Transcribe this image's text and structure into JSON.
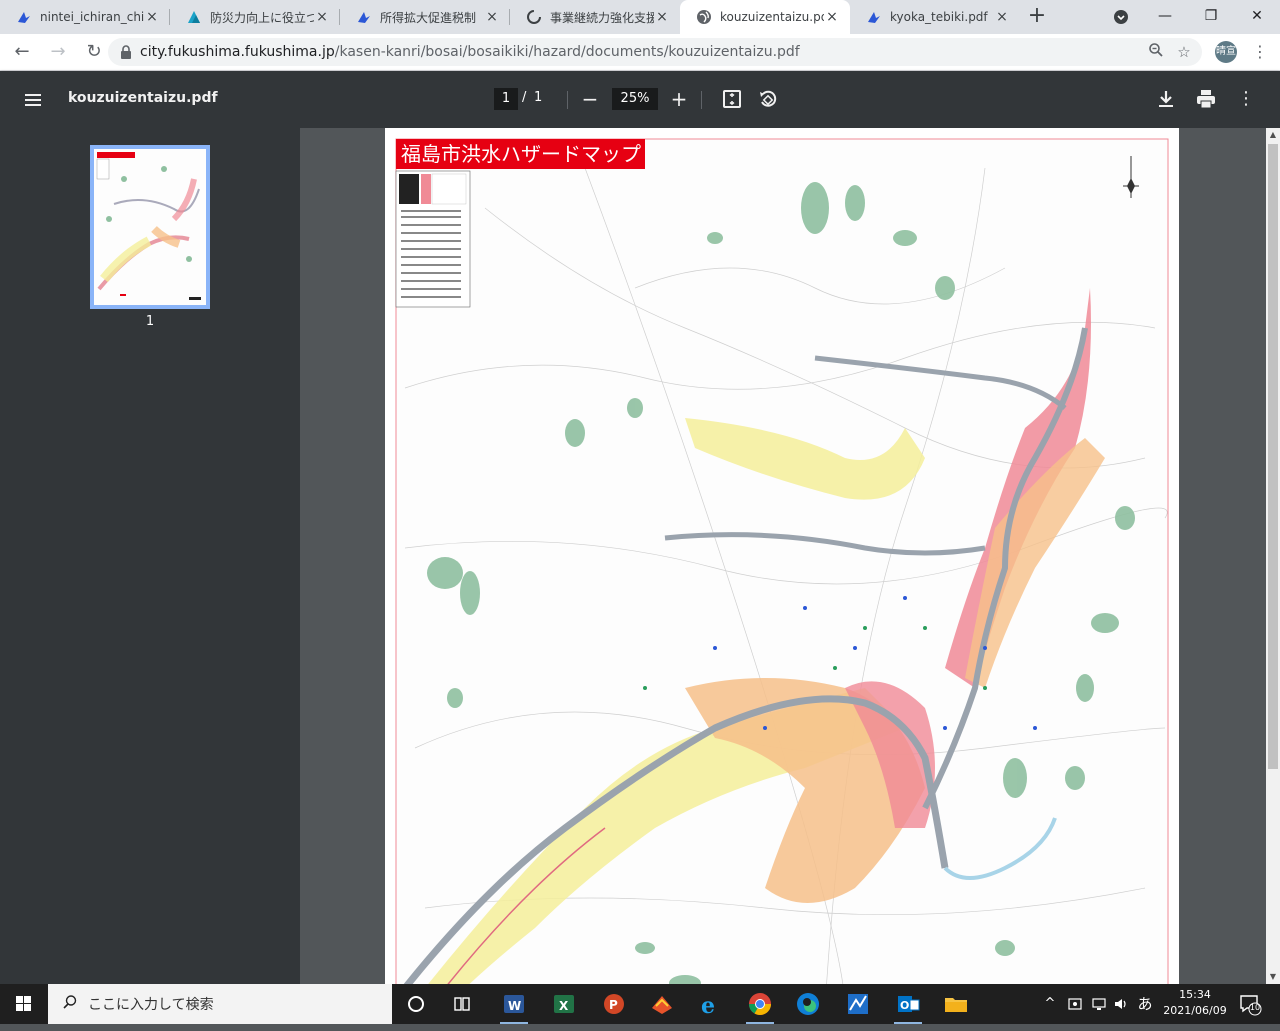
{
  "browser": {
    "tabs": [
      {
        "title": "nintei_ichiran_chiiki",
        "icon": "pdf-icon",
        "active": false
      },
      {
        "title": "防災力向上に役立つ",
        "icon": "site-icon",
        "active": false
      },
      {
        "title": "所得拡大促進税制 ",
        "icon": "pdf-icon",
        "active": false
      },
      {
        "title": "事業継続力強化支援",
        "icon": "loading-icon",
        "active": false
      },
      {
        "title": "kouzuizentaizu.pdf",
        "icon": "globe-icon",
        "active": true
      },
      {
        "title": "kyoka_tebiki.pdf",
        "icon": "pdf-icon",
        "active": false
      }
    ],
    "url_host": "city.fukushima.fukushima.jp",
    "url_path": "/kasen-kanri/bosai/bosaikiki/hazard/documents/kouzuizentaizu.pdf",
    "profile_initials": "晴宣"
  },
  "pdf": {
    "filename": "kouzuizentaizu.pdf",
    "current_page": "1",
    "page_separator": "/",
    "total_pages": "1",
    "zoom": "25%",
    "thumbnail_label": "1",
    "map_title": "福島市洪水ハザードマップ"
  },
  "taskbar": {
    "search_placeholder": "ここに入力して検索",
    "ime": "あ",
    "time": "15:34",
    "date": "2021/06/09",
    "notification_count": "10"
  },
  "colors": {
    "accent": "#1a73e8",
    "map_title_bg": "#e60012",
    "flood_yellow": "#f4ef9a",
    "flood_orange": "#f6c08a",
    "flood_pink": "#f08a96",
    "river": "#9aa3ad",
    "forest": "#8fc0a0"
  }
}
